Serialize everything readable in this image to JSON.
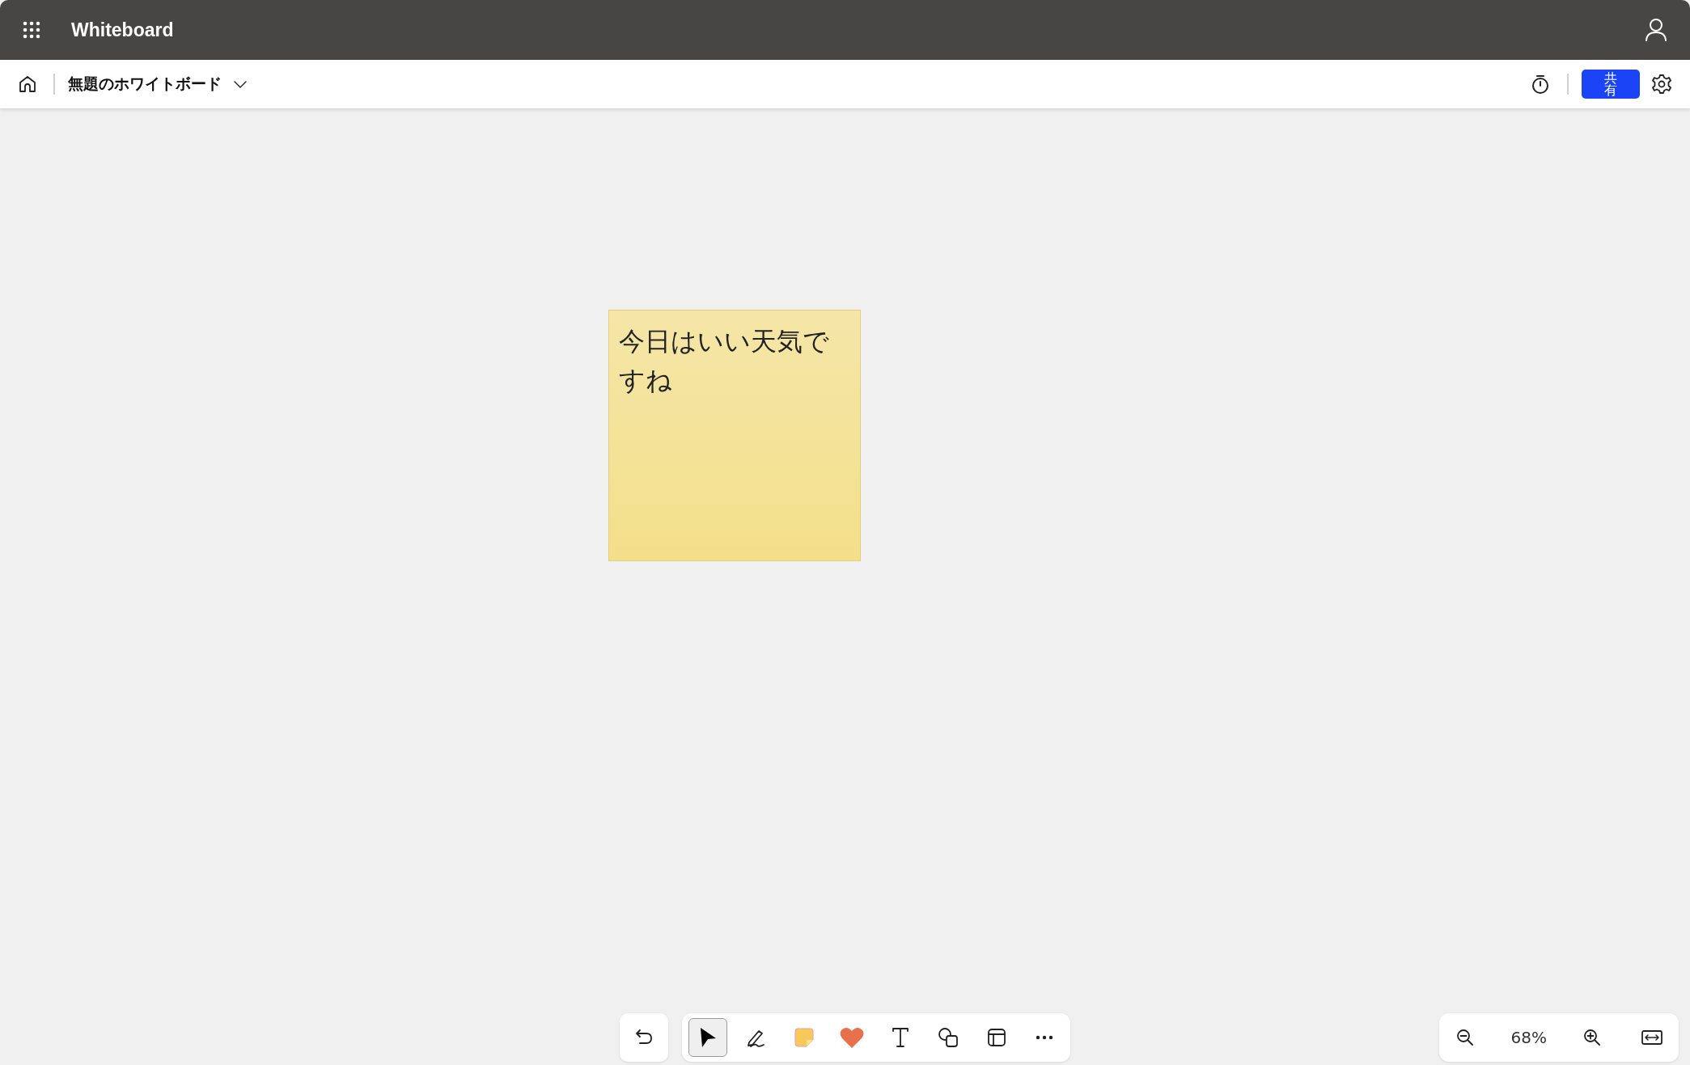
{
  "app_bar": {
    "title": "Whiteboard"
  },
  "board_bar": {
    "board_title": "無題のホワイトボード",
    "share_button": "共有"
  },
  "canvas": {
    "notes": [
      {
        "text": "今日はいい天気ですね",
        "color": "#f3df8a"
      }
    ]
  },
  "toolbar": {
    "tools": [
      {
        "kind": "select",
        "selected": true
      },
      {
        "kind": "pen",
        "selected": false
      },
      {
        "kind": "note",
        "selected": false
      },
      {
        "kind": "reaction",
        "selected": false
      },
      {
        "kind": "text",
        "selected": false
      },
      {
        "kind": "shapes",
        "selected": false
      },
      {
        "kind": "templates",
        "selected": false
      },
      {
        "kind": "more",
        "selected": false
      }
    ]
  },
  "zoom": {
    "level_text": "68%"
  }
}
